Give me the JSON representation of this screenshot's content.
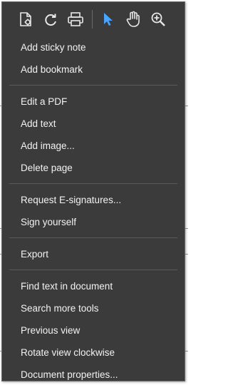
{
  "toolbar": {
    "icons": [
      "page-settings-icon",
      "rotate-icon",
      "print-icon",
      "select-cursor-icon",
      "hand-tool-icon",
      "zoom-in-icon"
    ]
  },
  "menu": {
    "groups": [
      [
        {
          "label": "Add sticky note"
        },
        {
          "label": "Add bookmark"
        }
      ],
      [
        {
          "label": "Edit a PDF"
        },
        {
          "label": "Add text"
        },
        {
          "label": "Add image..."
        },
        {
          "label": "Delete page"
        }
      ],
      [
        {
          "label": "Request E-signatures..."
        },
        {
          "label": "Sign yourself"
        }
      ],
      [
        {
          "label": "Export"
        }
      ],
      [
        {
          "label": "Find text in document"
        },
        {
          "label": "Search more tools"
        },
        {
          "label": "Previous view"
        },
        {
          "label": "Rotate view clockwise"
        },
        {
          "label": "Document properties..."
        }
      ]
    ]
  },
  "colors": {
    "menu_bg": "#3b3b3b",
    "accent": "#4aa3ff",
    "text": "#f2f2f2"
  }
}
